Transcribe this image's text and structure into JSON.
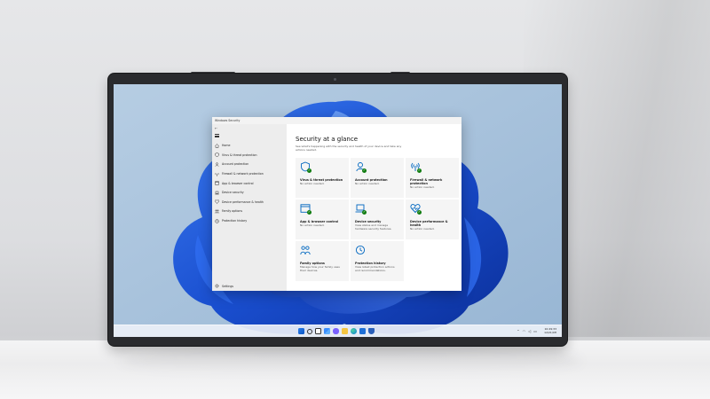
{
  "window": {
    "title": "Windows Security",
    "back_icon": "back-arrow-icon",
    "menu_icon": "hamburger-icon"
  },
  "sidebar": {
    "items": [
      {
        "label": "Home",
        "icon": "home-icon"
      },
      {
        "label": "Virus & threat protection",
        "icon": "shield-icon"
      },
      {
        "label": "Account protection",
        "icon": "person-icon"
      },
      {
        "label": "Firewall & network protection",
        "icon": "antenna-icon"
      },
      {
        "label": "App & browser control",
        "icon": "app-window-icon"
      },
      {
        "label": "Device security",
        "icon": "laptop-icon"
      },
      {
        "label": "Device performance & health",
        "icon": "heart-icon"
      },
      {
        "label": "Family options",
        "icon": "family-icon"
      },
      {
        "label": "Protection history",
        "icon": "history-icon"
      }
    ],
    "settings_label": "Settings"
  },
  "main": {
    "title": "Security at a glance",
    "subtitle": "See what's happening with the security and health of your device and take any actions needed.",
    "cards": [
      {
        "title": "Virus & threat protection",
        "status": "No action needed.",
        "icon": "shield-icon",
        "ok": true
      },
      {
        "title": "Account protection",
        "status": "No action needed.",
        "icon": "person-icon",
        "ok": true
      },
      {
        "title": "Firewall & network protection",
        "status": "No action needed.",
        "icon": "antenna-icon",
        "ok": true
      },
      {
        "title": "App & browser control",
        "status": "No action needed.",
        "icon": "app-window-icon",
        "ok": true
      },
      {
        "title": "Device security",
        "status": "View status and manage hardware security features.",
        "icon": "laptop-icon",
        "ok": true
      },
      {
        "title": "Device performance & health",
        "status": "No action needed.",
        "icon": "heart-icon",
        "ok": true
      },
      {
        "title": "Family options",
        "status": "Manage how your family uses their devices.",
        "icon": "family-icon",
        "ok": false
      },
      {
        "title": "Protection history",
        "status": "View latest protection actions and recommendations.",
        "icon": "history-icon",
        "ok": false
      }
    ]
  },
  "taskbar": {
    "icons": [
      "windows-start-icon",
      "search-icon",
      "task-view-icon",
      "widgets-icon",
      "chat-icon",
      "file-explorer-icon",
      "edge-icon",
      "store-icon",
      "security-icon"
    ],
    "tray_icons": [
      "chevron-up-icon",
      "wifi-icon",
      "volume-icon",
      "battery-icon"
    ],
    "time": "10:29:33",
    "date": "12/21/0H"
  },
  "colors": {
    "accent_blue": "#0067c0",
    "ok_green": "#107c10",
    "wallpaper_light": "#a9c3dc",
    "wallpaper_bloom": "#1e55d6"
  }
}
